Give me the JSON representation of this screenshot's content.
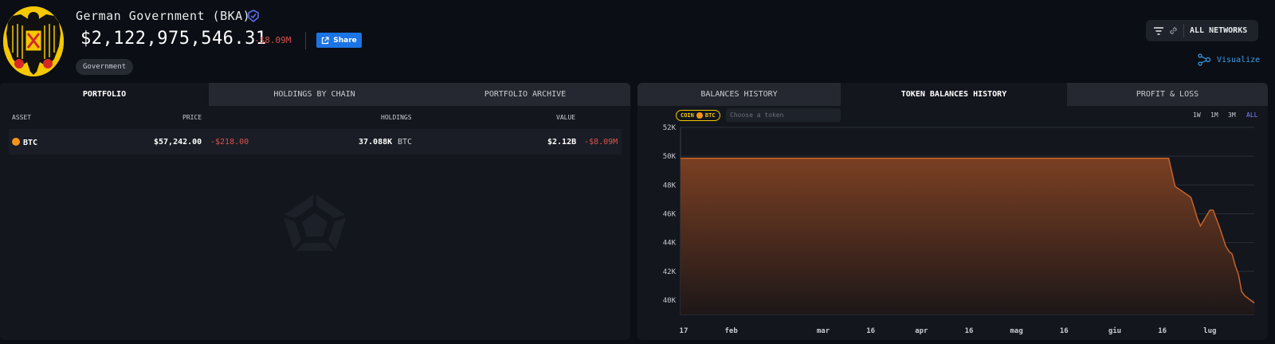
{
  "entity": {
    "name": "German Government (BKA)",
    "total_value": "$2,122,975,546.31",
    "change": "-$8.09M",
    "tag": "Government"
  },
  "header": {
    "share_label": "Share",
    "networks_label": "ALL NETWORKS",
    "visualize_label": "Visualize"
  },
  "left_panel": {
    "tabs": [
      {
        "label": "PORTFOLIO",
        "active": true
      },
      {
        "label": "HOLDINGS BY CHAIN",
        "active": false
      },
      {
        "label": "PORTFOLIO ARCHIVE",
        "active": false
      }
    ],
    "columns": {
      "asset": "ASSET",
      "price": "PRICE",
      "holdings": "HOLDINGS",
      "value": "VALUE"
    },
    "rows": [
      {
        "asset": "BTC",
        "price": "$57,242.00",
        "price_change": "-$218.00",
        "holdings": "37.088K",
        "holdings_unit": "BTC",
        "value": "$2.12B",
        "value_change": "-$8.09M"
      }
    ]
  },
  "right_panel": {
    "tabs": [
      {
        "label": "BALANCES HISTORY",
        "active": false
      },
      {
        "label": "TOKEN BALANCES HISTORY",
        "active": true
      },
      {
        "label": "PROFIT & LOSS",
        "active": false
      }
    ],
    "coin_badge": {
      "prefix": "COIN",
      "symbol": "BTC"
    },
    "token_placeholder": "Choose a token",
    "ranges": [
      {
        "label": "1W",
        "active": false
      },
      {
        "label": "1M",
        "active": false
      },
      {
        "label": "3M",
        "active": false
      },
      {
        "label": "ALL",
        "active": true
      }
    ]
  },
  "colors": {
    "accent": "#1b74e4",
    "negative": "#d9534f",
    "btc": "#f7931a",
    "chart_line": "#c8632a",
    "chart_fill_top": "#7a3f22",
    "chart_fill_bottom": "#1d1718",
    "range_active": "#7c83ff"
  },
  "chart_data": {
    "type": "area",
    "title": "",
    "xlabel": "",
    "ylabel": "",
    "ylim": [
      39000,
      52000
    ],
    "yticks": [
      40000,
      42000,
      44000,
      46000,
      48000,
      50000,
      52000
    ],
    "ytick_labels": [
      "40K",
      "42K",
      "44K",
      "46K",
      "48K",
      "50K",
      "52K"
    ],
    "xlim": [
      "2024-01-16",
      "2024-07-15"
    ],
    "xticks": [
      "2024-01-17",
      "2024-02-01",
      "2024-03-01",
      "2024-03-16",
      "2024-04-01",
      "2024-04-16",
      "2024-05-01",
      "2024-05-16",
      "2024-06-01",
      "2024-06-16",
      "2024-07-01"
    ],
    "xtick_labels": [
      "17",
      "feb",
      "mar",
      "16",
      "apr",
      "16",
      "mag",
      "16",
      "giu",
      "16",
      "lug"
    ],
    "grid": true,
    "series": [
      {
        "x": [
          "2024-01-16",
          "2024-06-18",
          "2024-06-19",
          "2024-06-20",
          "2024-06-24",
          "2024-06-25",
          "2024-06-26",
          "2024-06-27",
          "2024-06-28",
          "2024-07-01",
          "2024-07-02",
          "2024-07-04",
          "2024-07-06",
          "2024-07-07",
          "2024-07-08",
          "2024-07-09",
          "2024-07-10",
          "2024-07-11",
          "2024-07-12",
          "2024-07-15"
        ],
        "values": [
          49858,
          49858,
          48900,
          47900,
          47300,
          47150,
          46450,
          45700,
          45150,
          46250,
          46250,
          45100,
          43750,
          43400,
          43200,
          42400,
          41800,
          40600,
          40300,
          39800
        ]
      }
    ]
  }
}
